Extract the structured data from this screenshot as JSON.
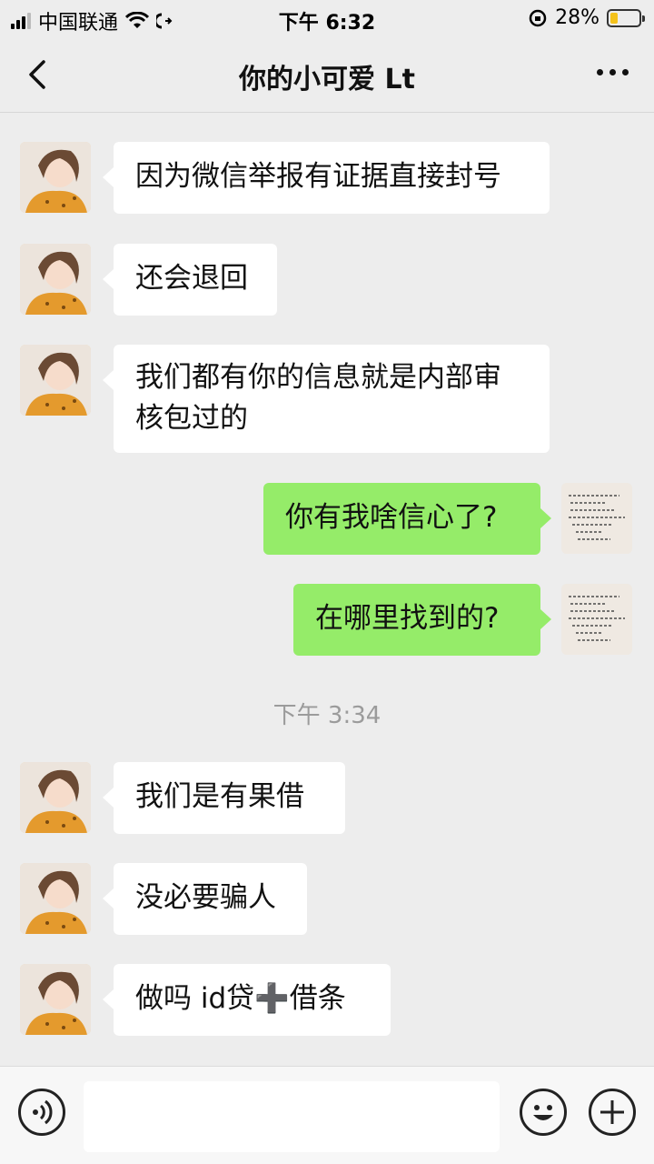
{
  "status_bar": {
    "carrier": "中国联通",
    "time": "下午 6:32",
    "battery": "28%",
    "battery_level": 0.28
  },
  "header": {
    "title": "你的小可爱 Lt"
  },
  "messages": [
    {
      "side": "in",
      "text": "因为微信举报有证据直接封号"
    },
    {
      "side": "in",
      "text": "还会退回"
    },
    {
      "side": "in",
      "text": "我们都有你的信息就是内部审核包过的"
    },
    {
      "side": "out",
      "text": "你有我啥信心了?"
    },
    {
      "side": "out",
      "text": "在哪里找到的?"
    },
    {
      "side": "in",
      "text": "我们是有果借"
    },
    {
      "side": "in",
      "text": "没必要骗人"
    },
    {
      "side": "in",
      "text": "做吗 id贷➕借条"
    }
  ],
  "timestamp": "下午 3:34",
  "icons": {
    "back": "chevron-left-icon",
    "more": "more-dots-icon",
    "voice": "voice-icon",
    "emoji": "emoji-icon",
    "add": "plus-icon"
  }
}
